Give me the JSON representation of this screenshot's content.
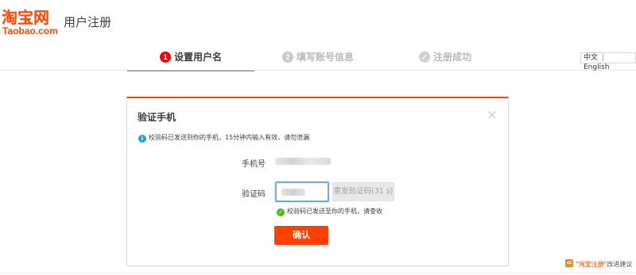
{
  "header": {
    "logo_cn": "淘宝网",
    "logo_en": "Taobao.com",
    "page_title": "用户注册"
  },
  "steps": [
    {
      "number": "1",
      "label": "设置用户名",
      "state": "active"
    },
    {
      "number": "2",
      "label": "填写账号信息",
      "state": "inactive"
    },
    {
      "number": "✓",
      "label": "注册成功",
      "state": "inactive"
    }
  ],
  "language": {
    "chinese": "中文",
    "separator": "|",
    "english": "English"
  },
  "dialog": {
    "title": "验证手机",
    "close_symbol": "×",
    "info_icon_symbol": "i",
    "info_text": "校验码已发送到你的手机，15分钟内输入有效，请勿泄漏",
    "phone_label": "手机号",
    "code_label": "验证码",
    "resend_label": "重发验证码(31 s)",
    "success_icon_symbol": "✓",
    "success_text": "校验码已发送至你的手机，请查收",
    "confirm_label": "确认"
  },
  "feedback": {
    "brand_text": "\"淘宝注册\"",
    "suffix_text": "改进建议"
  },
  "colors": {
    "brand": "#ff4400",
    "confirm_button": "#ff4000",
    "info_icon": "#1e9fe8",
    "success_icon": "#51b41c",
    "input_focus": "#72a7ee"
  }
}
